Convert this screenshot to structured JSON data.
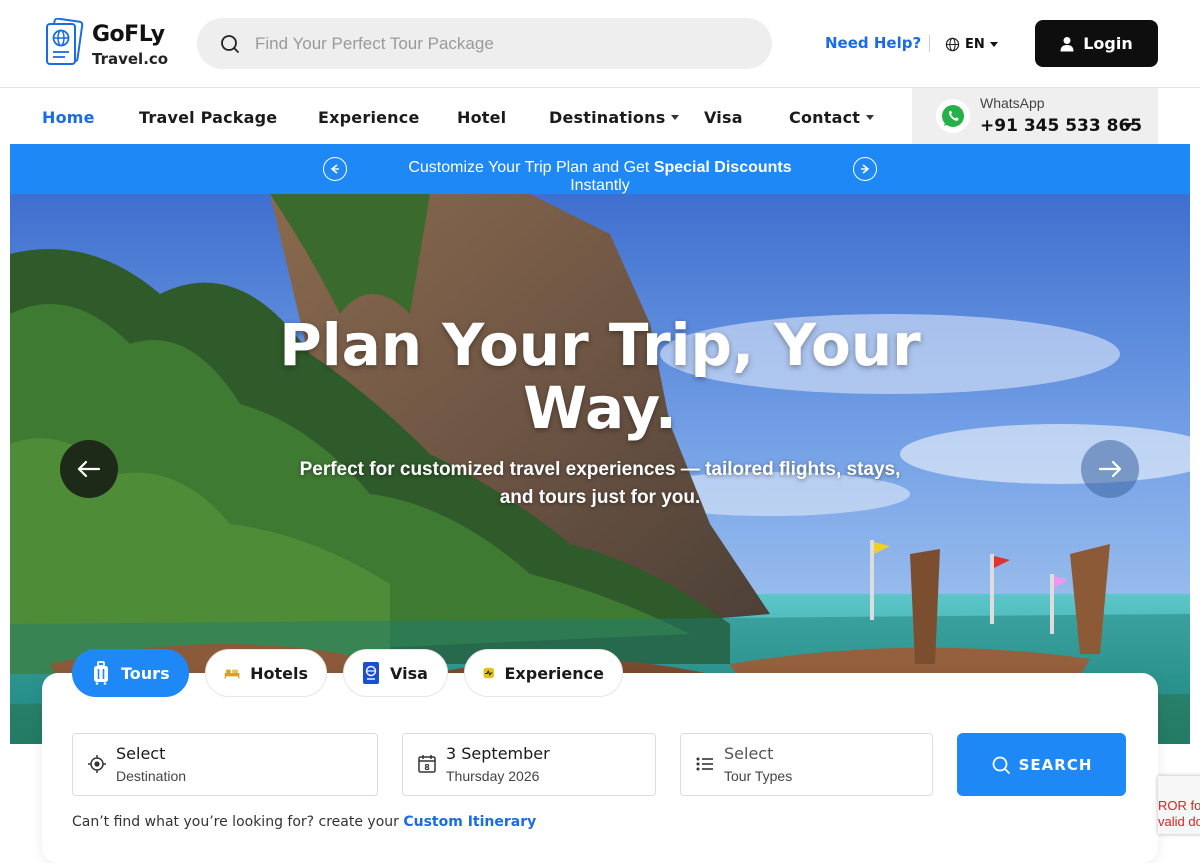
{
  "header": {
    "logo_title": "GoFLy",
    "logo_sub": "Travel.co",
    "search_placeholder": "Find Your Perfect Tour Package",
    "help_label": "Need Help?",
    "language": "EN",
    "login_label": "Login"
  },
  "nav": {
    "items": [
      {
        "label": "Home"
      },
      {
        "label": "Travel Package"
      },
      {
        "label": "Experience"
      },
      {
        "label": "Hotel"
      },
      {
        "label": "Destinations"
      },
      {
        "label": "Visa"
      },
      {
        "label": "Contact"
      }
    ],
    "whatsapp_label": "WhatsApp",
    "whatsapp_phone": "+91 345 533 865"
  },
  "promo": {
    "text_pre": "Customize Your Trip Plan and Get ",
    "text_bold": "Special Discounts",
    "text_post": " Instantly"
  },
  "hero": {
    "title": "Plan Your Trip, Your Way.",
    "subtitle": "Perfect for customized travel experiences — tailored flights, stays, and tours just for you."
  },
  "booking": {
    "tabs": [
      {
        "label": "Tours",
        "icon": "luggage-icon"
      },
      {
        "label": "Hotels",
        "icon": "bed-icon"
      },
      {
        "label": "Visa",
        "icon": "passport-icon"
      },
      {
        "label": "Experience",
        "icon": "activity-icon"
      }
    ],
    "active_tab": "Tours",
    "destination_main": "Select",
    "destination_sub": "Destination",
    "date_main": "3 September",
    "date_sub": "Thursday 2026",
    "date_icon_day": "8",
    "tour_type_main": "Select",
    "tour_type_sub": "Tour Types",
    "search_label": "SEARCH",
    "custom_text": "Can’t find what you’re looking for? create your ",
    "custom_link": "Custom Itinerary"
  },
  "recaptcha": {
    "line1": "ROR fo",
    "line2": "valid do"
  },
  "colors": {
    "accent": "#1e88f6",
    "link": "#1a6be8",
    "dark": "#0e0e0e"
  }
}
